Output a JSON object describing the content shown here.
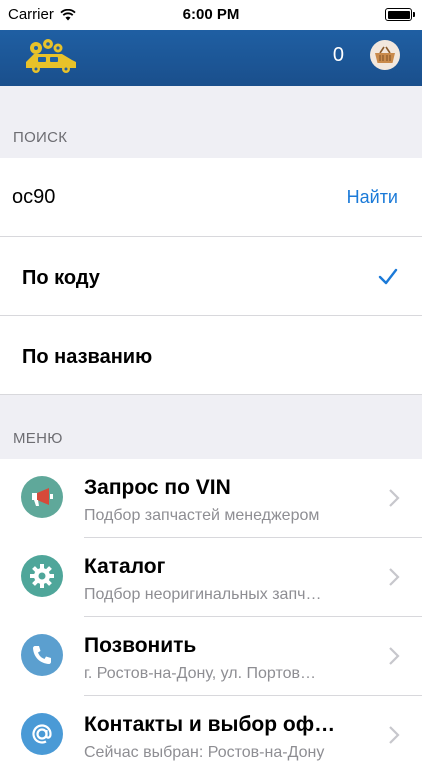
{
  "status_bar": {
    "carrier": "Carrier",
    "time": "6:00 PM",
    "battery_level": 1.0
  },
  "nav": {
    "cart_count": "0",
    "logo_icon": "gears-car-logo",
    "cart_icon": "basket-icon"
  },
  "search_section": {
    "header": "ПОИСК",
    "query": "oc90",
    "search_button": "Найти"
  },
  "search_mode": {
    "options": [
      {
        "label": "По коду",
        "selected": true
      },
      {
        "label": "По названию",
        "selected": false
      }
    ]
  },
  "menu_section": {
    "header": "МЕНЮ",
    "items": [
      {
        "title": "Запрос по VIN",
        "subtitle": "Подбор запчастей менеджером",
        "icon": "megaphone-icon",
        "icon_color": "#5fa89a"
      },
      {
        "title": "Каталог",
        "subtitle": "Подбор неоригинальных запч…",
        "icon": "gear-icon",
        "icon_color": "#4fa69a"
      },
      {
        "title": "Позвонить",
        "subtitle": "г. Ростов-на-Дону, ул. Портов…",
        "icon": "phone-icon",
        "icon_color": "#5b9fcf"
      },
      {
        "title": "Контакты и выбор оф…",
        "subtitle": "Сейчас выбран: Ростов-на-Дону",
        "icon": "at-sign-icon",
        "icon_color": "#4a9ad6"
      }
    ]
  },
  "colors": {
    "nav_bar": "#1f5fa3",
    "accent": "#1b7ad8",
    "background": "#efeff4"
  }
}
